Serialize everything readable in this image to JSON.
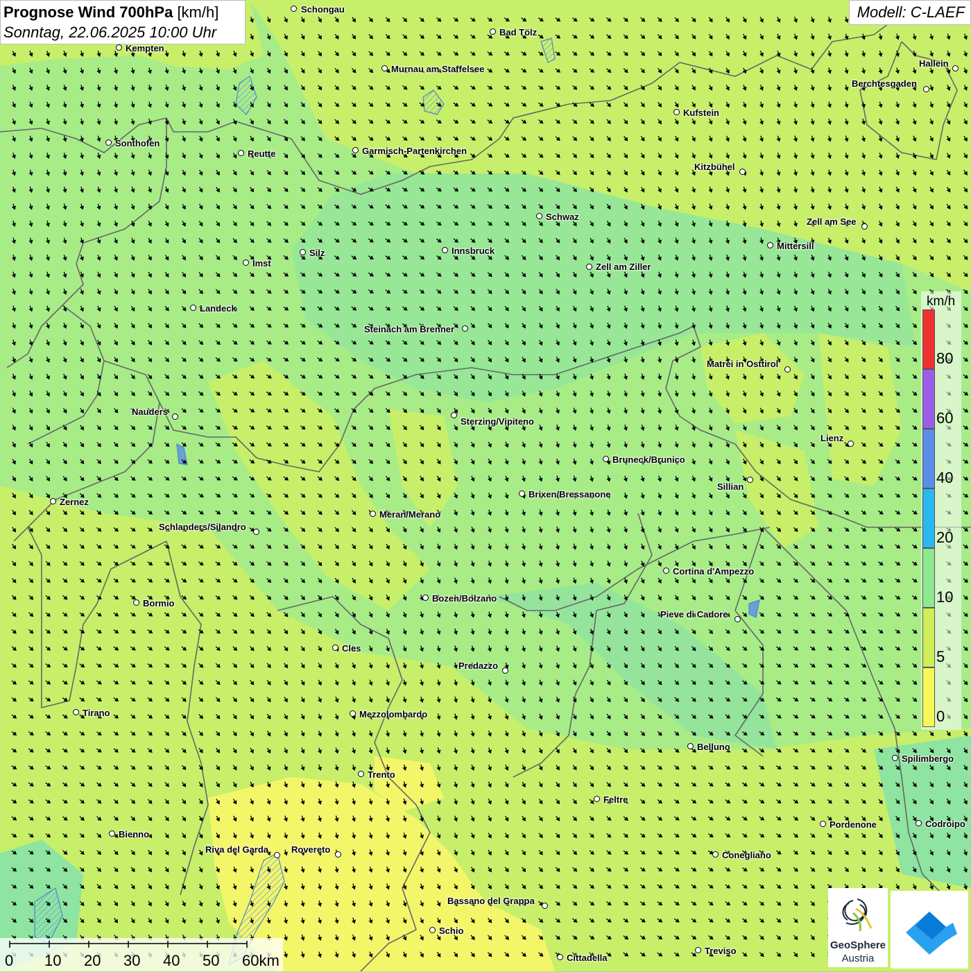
{
  "title": {
    "main_bold": "Prognose Wind 700hPa",
    "unit": "[km/h]",
    "datetime": "Sonntag, 22.06.2025 10:00 Uhr"
  },
  "model": "Modell: C-LAEF",
  "legend": {
    "unit": "km/h",
    "labels": [
      "80",
      "60",
      "40",
      "20",
      "10",
      "5",
      "0"
    ],
    "colors": [
      "#f03030",
      "#9a5ee8",
      "#5a8ee8",
      "#2ab8f0",
      "#8ee890",
      "#cfee58",
      "#f6f858"
    ]
  },
  "scale": {
    "labels": [
      "0",
      "10",
      "20",
      "30",
      "40",
      "50",
      "60km"
    ]
  },
  "logo": {
    "name": "GeoSphere",
    "sub": "Austria"
  },
  "cities": [
    {
      "name": "Schongau"
    },
    {
      "name": "Bad Tölz"
    },
    {
      "name": "Kempten"
    },
    {
      "name": "Murnau am Staffelsee"
    },
    {
      "name": "Hallein"
    },
    {
      "name": "Berchtesgaden"
    },
    {
      "name": "Kufstein"
    },
    {
      "name": "Sonthofen"
    },
    {
      "name": "Reutte"
    },
    {
      "name": "Garmisch-Partenkirchen"
    },
    {
      "name": "Kitzbühel"
    },
    {
      "name": "Schwaz"
    },
    {
      "name": "Zell am See"
    },
    {
      "name": "Mittersill"
    },
    {
      "name": "Innsbruck"
    },
    {
      "name": "Silz"
    },
    {
      "name": "Imst"
    },
    {
      "name": "Zell am Ziller"
    },
    {
      "name": "Landeck"
    },
    {
      "name": "Steinach am Brenner"
    },
    {
      "name": "Matrei in Osttirol"
    },
    {
      "name": "Nauders"
    },
    {
      "name": "Sterzing/Vipiteno"
    },
    {
      "name": "Lienz"
    },
    {
      "name": "Bruneck/Brunico"
    },
    {
      "name": "Sillian"
    },
    {
      "name": "Brixen/Bressanone"
    },
    {
      "name": "Zernez"
    },
    {
      "name": "Meran/Merano"
    },
    {
      "name": "Schlanders/Silandro"
    },
    {
      "name": "Cortina d'Ampezzo"
    },
    {
      "name": "Bozen/Bolzano"
    },
    {
      "name": "Bormio"
    },
    {
      "name": "Pieve di Cadore"
    },
    {
      "name": "Cles"
    },
    {
      "name": "Predazzo"
    },
    {
      "name": "Tirano"
    },
    {
      "name": "Mezzolombardo"
    },
    {
      "name": "Belluno"
    },
    {
      "name": "Spilimbergo"
    },
    {
      "name": "Trento"
    },
    {
      "name": "Feltre"
    },
    {
      "name": "Pordenone"
    },
    {
      "name": "Codroipo"
    },
    {
      "name": "Bienno"
    },
    {
      "name": "Riva del Garda"
    },
    {
      "name": "Rovereto"
    },
    {
      "name": "Conegliano"
    },
    {
      "name": "Bassano del Grappa"
    },
    {
      "name": "Schio"
    },
    {
      "name": "Treviso"
    },
    {
      "name": "Cittadella"
    }
  ]
}
